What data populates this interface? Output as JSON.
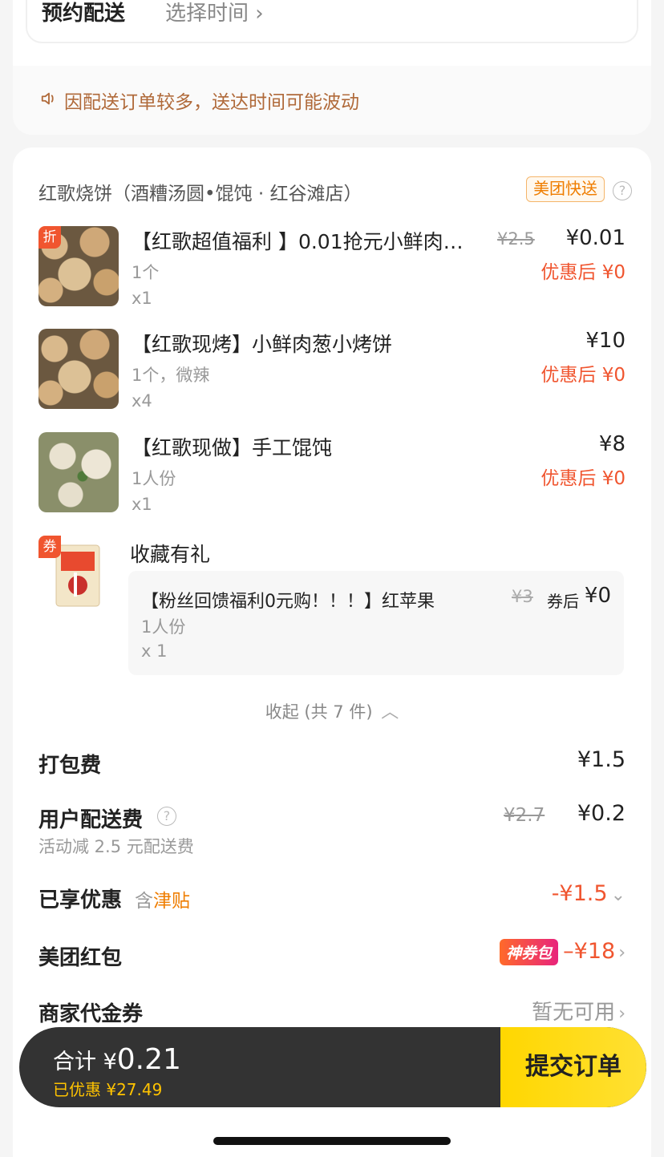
{
  "schedule": {
    "label": "预约配送",
    "value": "选择时间 ›"
  },
  "notice": {
    "text": "因配送订单较多，送达时间可能波动"
  },
  "shop": {
    "name": "红歌烧饼（酒糟汤圆•馄饨 · 红谷滩店）",
    "badge": "美团快送",
    "help": "?"
  },
  "items": [
    {
      "tag": "折",
      "title": "【红歌超值福利 】0.01抢元小鲜肉…",
      "spec": "1个",
      "qty": "x1",
      "orig_price": "¥2.5",
      "price": "¥0.01",
      "after": "优惠后 ¥0"
    },
    {
      "title": "【红歌现烤】小鲜肉葱小烤饼",
      "spec": "1个，微辣",
      "qty": "x4",
      "price": "¥10",
      "after": "优惠后 ¥0"
    },
    {
      "title": "【红歌现做】手工馄饨",
      "spec": "1人份",
      "qty": "x1",
      "price": "¥8",
      "after": "优惠后 ¥0"
    }
  ],
  "gift": {
    "tag": "券",
    "title": "收藏有礼",
    "name": "【粉丝回馈福利0元购！！！】红苹果",
    "orig_price": "¥3",
    "after_label": "券后",
    "price": "¥0",
    "spec": "1人份",
    "qty": "x 1"
  },
  "collapse": {
    "label": "收起 (共 7 件)",
    "icon": "chevron-up-icon"
  },
  "fees": {
    "packing": {
      "label": "打包费",
      "value": "¥1.5"
    },
    "delivery": {
      "label": "用户配送费",
      "orig": "¥2.7",
      "value": "¥0.2",
      "sub": "活动减 2.5 元配送费"
    },
    "discount": {
      "label": "已享优惠",
      "prefix": "含",
      "subsidy": "津贴",
      "value": "-¥1.5"
    },
    "redpacket": {
      "label": "美团红包",
      "badge": "神券包",
      "value": "–¥18"
    },
    "voucher": {
      "label": "商家代金券",
      "value": "暂无可用"
    }
  },
  "bottom": {
    "total_label": "合计",
    "currency": "¥",
    "total": "0.21",
    "saved": "已优惠 ¥27.49",
    "submit": "提交订单"
  },
  "colors": {
    "accent": "#f0552f",
    "brand_yellow": "#ffd700",
    "orange": "#ef7d00"
  }
}
